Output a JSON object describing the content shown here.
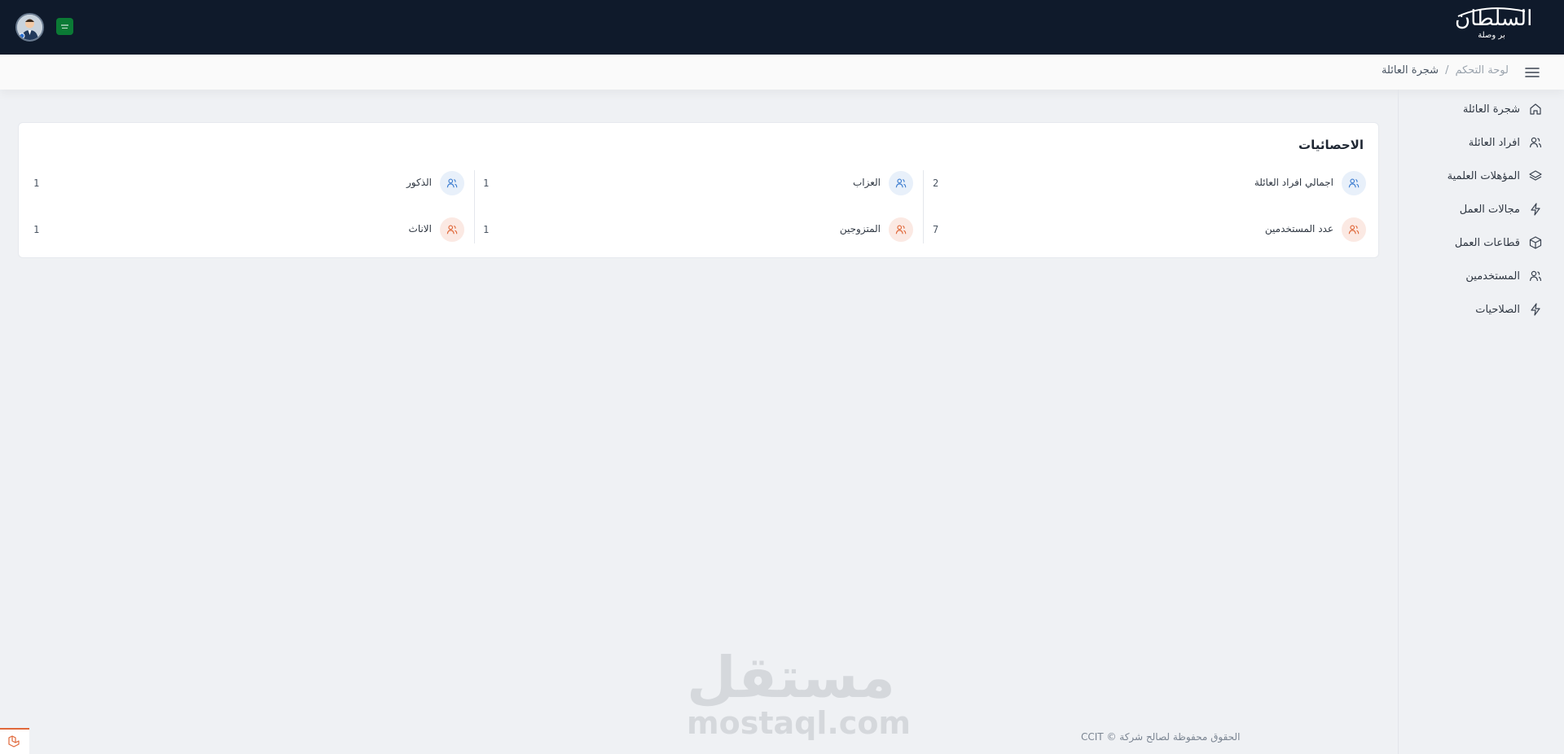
{
  "header": {
    "logo_main": "السلطان",
    "logo_sub": "بر وصلة",
    "flag_label": "SA"
  },
  "breadcrumb": {
    "home": "لوحة التحكم",
    "separator": "/",
    "current": "شجرة العائلة"
  },
  "sidebar": {
    "items": [
      {
        "label": "شجرة العائلة",
        "icon": "home-icon"
      },
      {
        "label": "افراد العائلة",
        "icon": "users-icon"
      },
      {
        "label": "المؤهلات العلمية",
        "icon": "layers-icon"
      },
      {
        "label": "مجالات العمل",
        "icon": "lightning-icon"
      },
      {
        "label": "قطاعات العمل",
        "icon": "box-icon"
      },
      {
        "label": "المستخدمين",
        "icon": "users-icon"
      },
      {
        "label": "الصلاحيات",
        "icon": "lightning-icon"
      }
    ]
  },
  "stats": {
    "title": "الاحصائيات",
    "items": [
      {
        "label": "اجمالي افراد العائلة",
        "value": "2",
        "color": "#3f7fd1"
      },
      {
        "label": "العزاب",
        "value": "1",
        "color": "#3f7fd1"
      },
      {
        "label": "الذكور",
        "value": "1",
        "color": "#3f7fd1"
      },
      {
        "label": "عدد المستخدمين",
        "value": "7",
        "color": "#e0683a"
      },
      {
        "label": "المتزوجين",
        "value": "1",
        "color": "#e0683a"
      },
      {
        "label": "الاناث",
        "value": "1",
        "color": "#e0683a"
      }
    ]
  },
  "watermark": {
    "arabic": "مستقل",
    "latin": "mostaql.com"
  },
  "footer": {
    "text": "الحقوق محفوظة لصالح شركة © CCIT"
  },
  "colors": {
    "topbar": "#0f1a2b",
    "accent_blue": "#3f7fd1",
    "accent_orange": "#e0683a"
  }
}
